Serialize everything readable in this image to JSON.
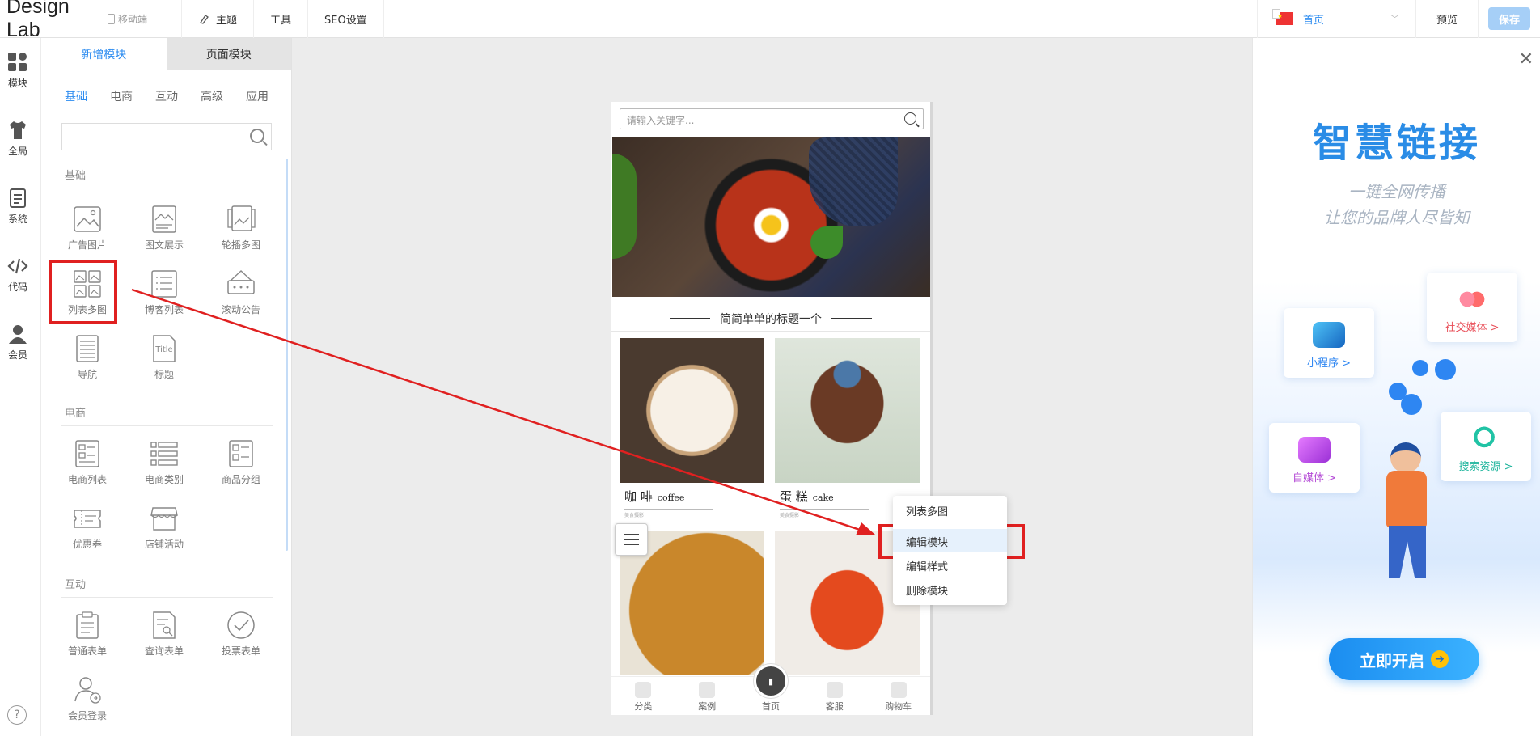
{
  "topbar": {
    "brand": "Design Lab",
    "device_label": "移动端",
    "nav": [
      {
        "label": "主题",
        "icon": "brush-icon"
      },
      {
        "label": "工具",
        "icon": ""
      },
      {
        "label": "SEO设置",
        "icon": ""
      }
    ],
    "page_select": "首页",
    "preview_label": "预览",
    "save_label": "保存"
  },
  "rail": {
    "items": [
      {
        "label": "模块",
        "icon": "grid-icon"
      },
      {
        "label": "全局",
        "icon": "shirt-icon"
      },
      {
        "label": "系统",
        "icon": "document-icon"
      },
      {
        "label": "代码",
        "icon": "code-icon"
      },
      {
        "label": "会员",
        "icon": "user-icon"
      }
    ],
    "help": "?"
  },
  "panel": {
    "tabs": [
      "新增模块",
      "页面模块"
    ],
    "subtabs": [
      "基础",
      "电商",
      "互动",
      "高级",
      "应用"
    ],
    "search_placeholder": "",
    "sections": [
      {
        "title": "基础",
        "modules": [
          "广告图片",
          "图文展示",
          "轮播多图",
          "列表多图",
          "博客列表",
          "滚动公告",
          "导航",
          "标题"
        ]
      },
      {
        "title": "电商",
        "modules": [
          "电商列表",
          "电商类别",
          "商品分组",
          "优惠券",
          "店铺活动"
        ]
      },
      {
        "title": "互动",
        "modules": [
          "普通表单",
          "查询表单",
          "投票表单",
          "会员登录"
        ]
      }
    ]
  },
  "phone": {
    "search_placeholder": "请输入关键字...",
    "section_title": "简简单单的标题一个",
    "items": [
      {
        "name": "咖 啡",
        "en": "coffee",
        "tiny": "美食摄影"
      },
      {
        "name": "蛋 糕",
        "en": "cake",
        "tiny": "美食摄影"
      }
    ],
    "tabbar": [
      "分类",
      "案例",
      "首页",
      "客服",
      "购物车"
    ]
  },
  "context_menu": {
    "items": [
      "列表多图",
      "编辑模块",
      "编辑样式",
      "删除模块"
    ],
    "highlighted": "编辑模块"
  },
  "promo": {
    "headline": "智慧链接",
    "sub1": "一键全网传播",
    "sub2": "让您的品牌人尽皆知",
    "cards": [
      "社交媒体 >",
      "小程序 >",
      "自媒体 >",
      "搜索资源 >"
    ],
    "cta": "立即开启"
  },
  "colors": {
    "accent": "#2d8cf0",
    "annotation_red": "#e02020",
    "save_disabled": "#a6cff7",
    "promo_blue": "#2a8ce6"
  }
}
